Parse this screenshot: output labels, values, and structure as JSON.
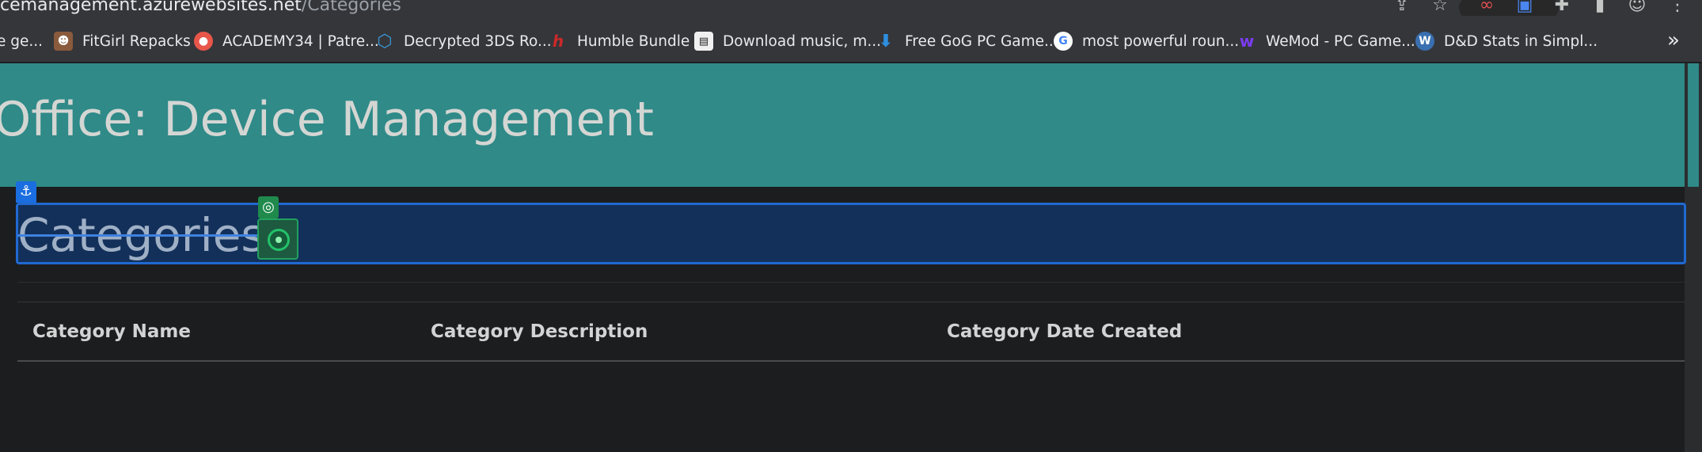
{
  "browser": {
    "url_host": "cemanagement.azurewebsites.net",
    "url_path": "/Categories",
    "toolbar_icons": [
      "share-icon",
      "star-icon",
      "glasses-extension-icon",
      "extension-blue-icon",
      "puzzle-extensions-icon",
      "sidepanel-icon",
      "profile-avatar-icon",
      "menu-kebab-icon"
    ]
  },
  "bookmarks": [
    {
      "label": "e ge...",
      "icon": "generic-favicon",
      "color": "#35363a"
    },
    {
      "label": "FitGirl Repacks",
      "icon": "fitgirl-favicon",
      "color": "#8a5a3c"
    },
    {
      "label": "ACADEMY34 | Patre...",
      "icon": "patreon-favicon",
      "color": "#e8564a"
    },
    {
      "label": "Decrypted 3DS Ro...",
      "icon": "hexagon-favicon",
      "color": "#3a9ad9"
    },
    {
      "label": "Humble Bundle",
      "icon": "humble-favicon",
      "color": "#cc2929"
    },
    {
      "label": "Download music, m...",
      "icon": "download-site-favicon",
      "color": "#f0f0f0"
    },
    {
      "label": "Free GoG PC Game...",
      "icon": "download-arrow-favicon",
      "color": "#2e8fe0"
    },
    {
      "label": "most powerful roun...",
      "icon": "google-favicon",
      "color": "#ffffff"
    },
    {
      "label": "WeMod - PC Game...",
      "icon": "wemod-favicon",
      "color": "#7b3cf0"
    },
    {
      "label": "D&D Stats in Simpl...",
      "icon": "wordpress-favicon",
      "color": "#3a6fb0"
    }
  ],
  "bookmarks_more": "»",
  "site": {
    "title": "Office: Device Management"
  },
  "page": {
    "heading": "Categories",
    "anchor_badge": "⚓",
    "table_headers": [
      "Category Name",
      "Category Description",
      "Category Date Created"
    ]
  },
  "colors": {
    "header_bg": "#2f8a88",
    "highlight_bg": "#13305a",
    "highlight_border": "#2069d0",
    "page_bg": "#1c1d1f"
  }
}
